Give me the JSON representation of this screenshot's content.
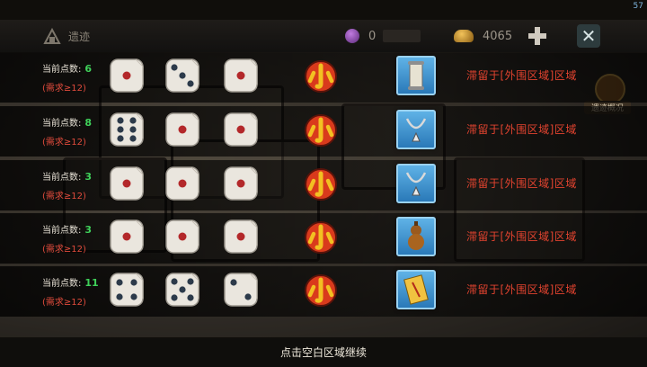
{
  "fps": "57",
  "header": {
    "title": "遗迹",
    "gem_count": "0",
    "coin_count": "4065"
  },
  "side_button": {
    "label": "遗迹概况"
  },
  "rows": [
    {
      "label": "当前点数:",
      "points": "6",
      "need": "(需求≥12)",
      "dice": [
        1,
        3,
        1
      ],
      "item_icon": "scroll-icon",
      "status": "滞留于[外围区域]区域"
    },
    {
      "label": "当前点数:",
      "points": "8",
      "need": "(需求≥12)",
      "dice": [
        6,
        1,
        1
      ],
      "item_icon": "necklace-icon",
      "status": "滞留于[外围区域]区域"
    },
    {
      "label": "当前点数:",
      "points": "3",
      "need": "(需求≥12)",
      "dice": [
        1,
        1,
        1
      ],
      "item_icon": "necklace-icon",
      "status": "滞留于[外围区域]区域"
    },
    {
      "label": "当前点数:",
      "points": "3",
      "need": "(需求≥12)",
      "dice": [
        1,
        1,
        1
      ],
      "item_icon": "gourd-icon",
      "status": "滞留于[外围区域]区域"
    },
    {
      "label": "当前点数:",
      "points": "11",
      "need": "(需求≥12)",
      "dice": [
        4,
        5,
        2
      ],
      "item_icon": "talisman-icon",
      "status": "滞留于[外围区域]区域"
    }
  ],
  "footer": {
    "hint": "点击空白区域继续"
  },
  "colors": {
    "points": "#3fd15a",
    "need": "#e04b3c",
    "status": "#e2432f",
    "item_bg": "#3a8fd0"
  }
}
